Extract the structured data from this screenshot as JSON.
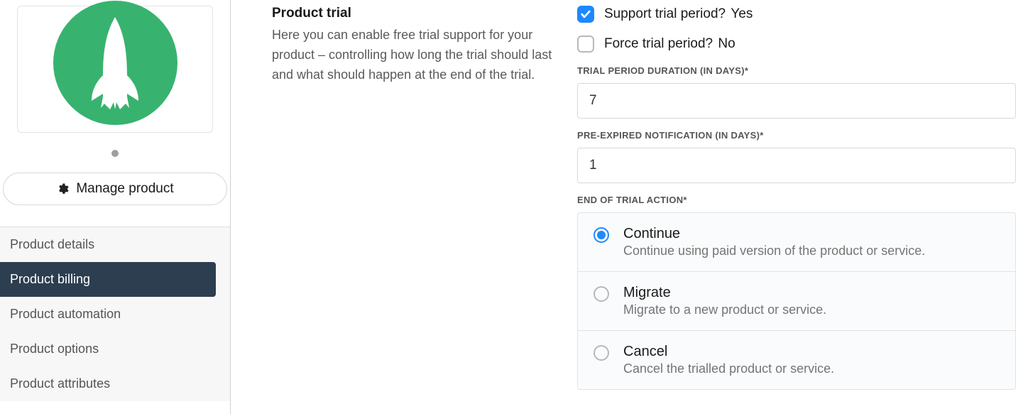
{
  "sidebar": {
    "manage_label": "Manage product",
    "nav": [
      {
        "label": "Product details"
      },
      {
        "label": "Product billing"
      },
      {
        "label": "Product automation"
      },
      {
        "label": "Product options"
      },
      {
        "label": "Product attributes"
      }
    ],
    "active_index": 1
  },
  "section": {
    "title": "Product trial",
    "description": "Here you can enable free trial support for your product – controlling how long the trial should last and what should happen at the end of the trial."
  },
  "trial": {
    "support_label": "Support trial period?",
    "support_value": "Yes",
    "support_checked": true,
    "force_label": "Force trial period?",
    "force_value": "No",
    "force_checked": false,
    "duration_label": "TRIAL PERIOD DURATION (IN DAYS)*",
    "duration_value": "7",
    "preexpire_label": "PRE-EXPIRED NOTIFICATION (IN DAYS)*",
    "preexpire_value": "1",
    "end_action_label": "END OF TRIAL ACTION*",
    "end_action_selected": 0,
    "end_actions": [
      {
        "title": "Continue",
        "desc": "Continue using paid version of the product or service."
      },
      {
        "title": "Migrate",
        "desc": "Migrate to a new product or service."
      },
      {
        "title": "Cancel",
        "desc": "Cancel the trialled product or service."
      }
    ]
  },
  "colors": {
    "accent": "#1e88ff",
    "logo_bg": "#37b36f",
    "nav_active_bg": "#2c3e50"
  }
}
